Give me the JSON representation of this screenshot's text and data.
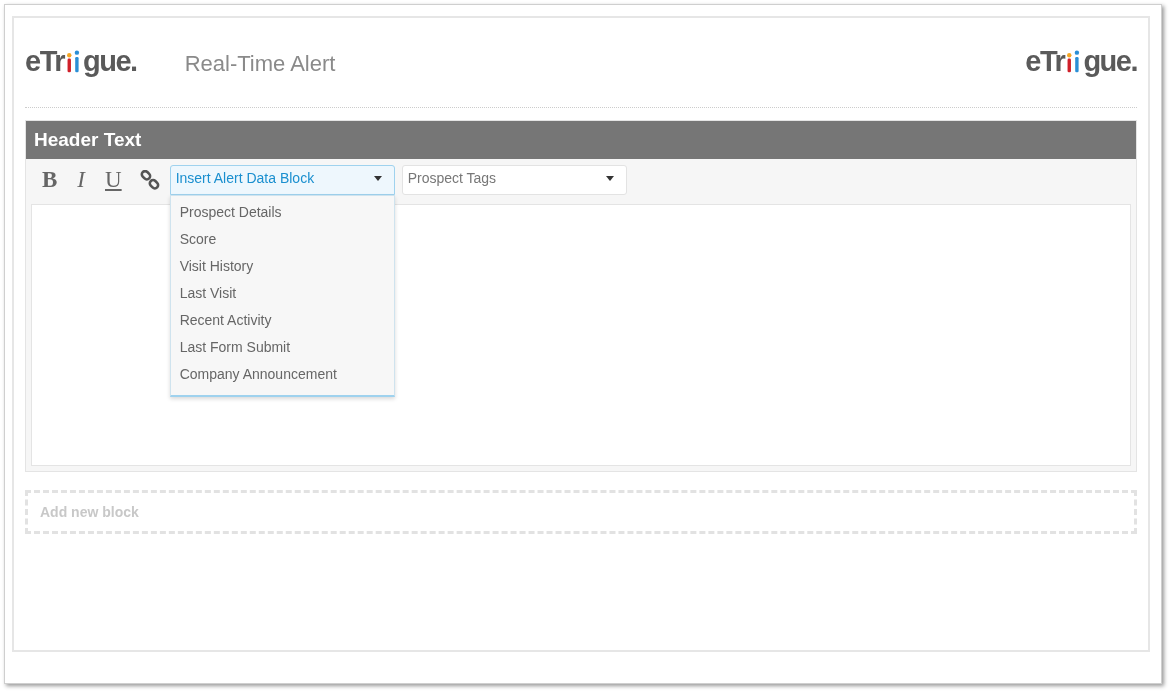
{
  "header": {
    "logo_left": {
      "start": "eTr",
      "end": "gue."
    },
    "title": "Real-Time Alert",
    "logo_right": {
      "start": "eTr",
      "end": "gue."
    }
  },
  "block": {
    "title": "Header Text",
    "toolbar": {
      "format_buttons": [
        {
          "label": "B",
          "kind": "bold"
        },
        {
          "label": "I",
          "kind": "italic"
        },
        {
          "label": "U",
          "kind": "underline"
        }
      ],
      "data_block_select": {
        "label": "Insert Alert Data Block",
        "expanded": true,
        "options": [
          "Prospect Details",
          "Score",
          "Visit History",
          "Last Visit",
          "Recent Activity",
          "Last Form Submit",
          "Company Announcement"
        ]
      },
      "tags_select": {
        "label": "Prospect Tags",
        "expanded": false
      }
    }
  },
  "add_block": {
    "label": "Add new block"
  }
}
